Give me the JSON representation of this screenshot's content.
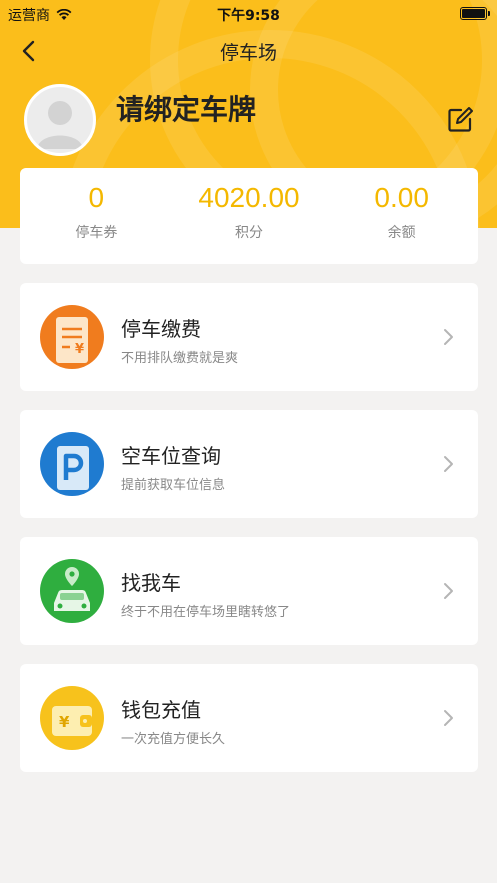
{
  "status_bar": {
    "carrier": "运营商",
    "time": "下午9:58"
  },
  "nav": {
    "title": "停车场",
    "back_icon": "chevron-left-icon"
  },
  "profile": {
    "plate_prompt": "请绑定车牌",
    "edit_icon": "edit-icon"
  },
  "stats": [
    {
      "value": "0",
      "label": "停车券"
    },
    {
      "value": "4020.00",
      "label": "积分"
    },
    {
      "value": "0.00",
      "label": "余额"
    }
  ],
  "menu": [
    {
      "title": "停车缴费",
      "subtitle": "不用排队缴费就是爽",
      "icon": "bill-icon",
      "color": "#f07c1e"
    },
    {
      "title": "空车位查询",
      "subtitle": "提前获取车位信息",
      "icon": "parking-icon",
      "color": "#1f7bd0"
    },
    {
      "title": "找我车",
      "subtitle": "终于不用在停车场里瞎转悠了",
      "icon": "car-location-icon",
      "color": "#2fae3f"
    },
    {
      "title": "钱包充值",
      "subtitle": "一次充值方便长久",
      "icon": "wallet-icon",
      "color": "#f7c21c"
    }
  ],
  "colors": {
    "header": "#fbbe1b",
    "accent": "#f4b800"
  }
}
